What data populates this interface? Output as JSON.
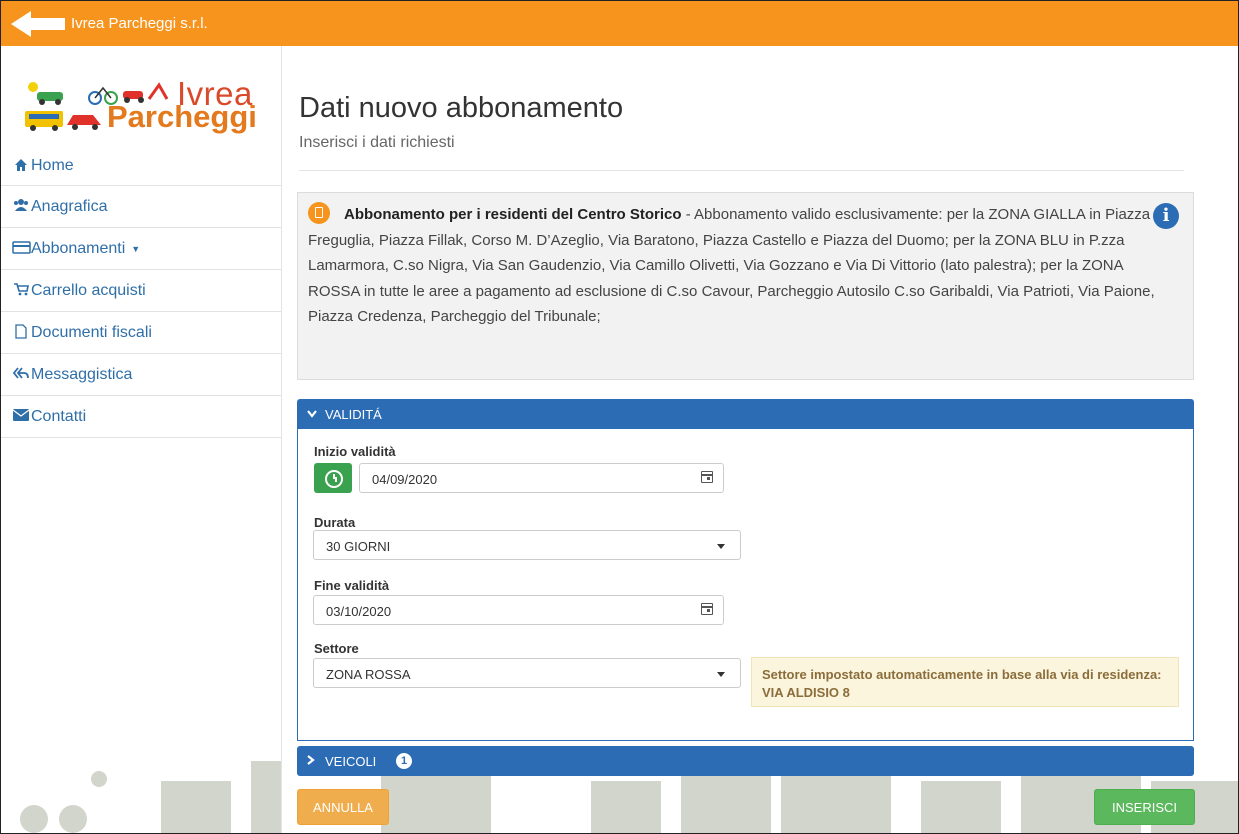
{
  "app": {
    "title": "Ivrea Parcheggi s.r.l."
  },
  "logo": {
    "line1": "Ivrea",
    "line2": "Parcheggi"
  },
  "sidebar": {
    "items": [
      {
        "label": "Home",
        "icon": "home-icon"
      },
      {
        "label": "Anagrafica",
        "icon": "users-icon"
      },
      {
        "label": "Abbonamenti",
        "icon": "card-icon",
        "has_dropdown": true
      },
      {
        "label": "Carrello acquisti",
        "icon": "cart-icon"
      },
      {
        "label": "Documenti fiscali",
        "icon": "file-icon"
      },
      {
        "label": "Messaggistica",
        "icon": "reply-all-icon"
      },
      {
        "label": "Contatti",
        "icon": "envelope-icon"
      }
    ]
  },
  "page": {
    "title": "Dati nuovo abbonamento",
    "subtitle": "Inserisci i dati richiesti"
  },
  "info_box": {
    "heading": "Abbonamento per i residenti del Centro Storico",
    "text": " - Abbonamento valido esclusivamente: per la ZONA GIALLA in Piazza Freguglia, Piazza Fillak, Corso M. D’Azeglio, Via Baratono, Piazza Castello e Piazza del Duomo; per la ZONA BLU in P.zza Lamarmora, C.so Nigra, Via San Gaudenzio, Via Camillo Olivetti, Via Gozzano e Via Di Vittorio (lato palestra); per la ZONA ROSSA in tutte le aree a pagamento ad esclusione di C.so Cavour, Parcheggio Autosilo C.so Garibaldi, Via Patrioti, Via Paione, Piazza Credenza, Parcheggio del Tribunale;"
  },
  "validita": {
    "header": "VALIDITÁ",
    "inizio_label": "Inizio validità",
    "inizio_value": "04/09/2020",
    "durata_label": "Durata",
    "durata_value": "30 GIORNI",
    "fine_label": "Fine validità",
    "fine_value": "03/10/2020",
    "settore_label": "Settore",
    "settore_value": "ZONA ROSSA",
    "settore_hint": "Settore impostato automaticamente in base alla via di residenza: VIA ALDISIO 8"
  },
  "veicoli": {
    "header": "VEICOLI",
    "count": "1"
  },
  "actions": {
    "cancel": "ANNULLA",
    "submit": "INSERISCI"
  },
  "colors": {
    "topbar": "#f7941d",
    "primary": "#2b6cb4",
    "success": "#5cb85c",
    "warning": "#f0ad4e"
  }
}
